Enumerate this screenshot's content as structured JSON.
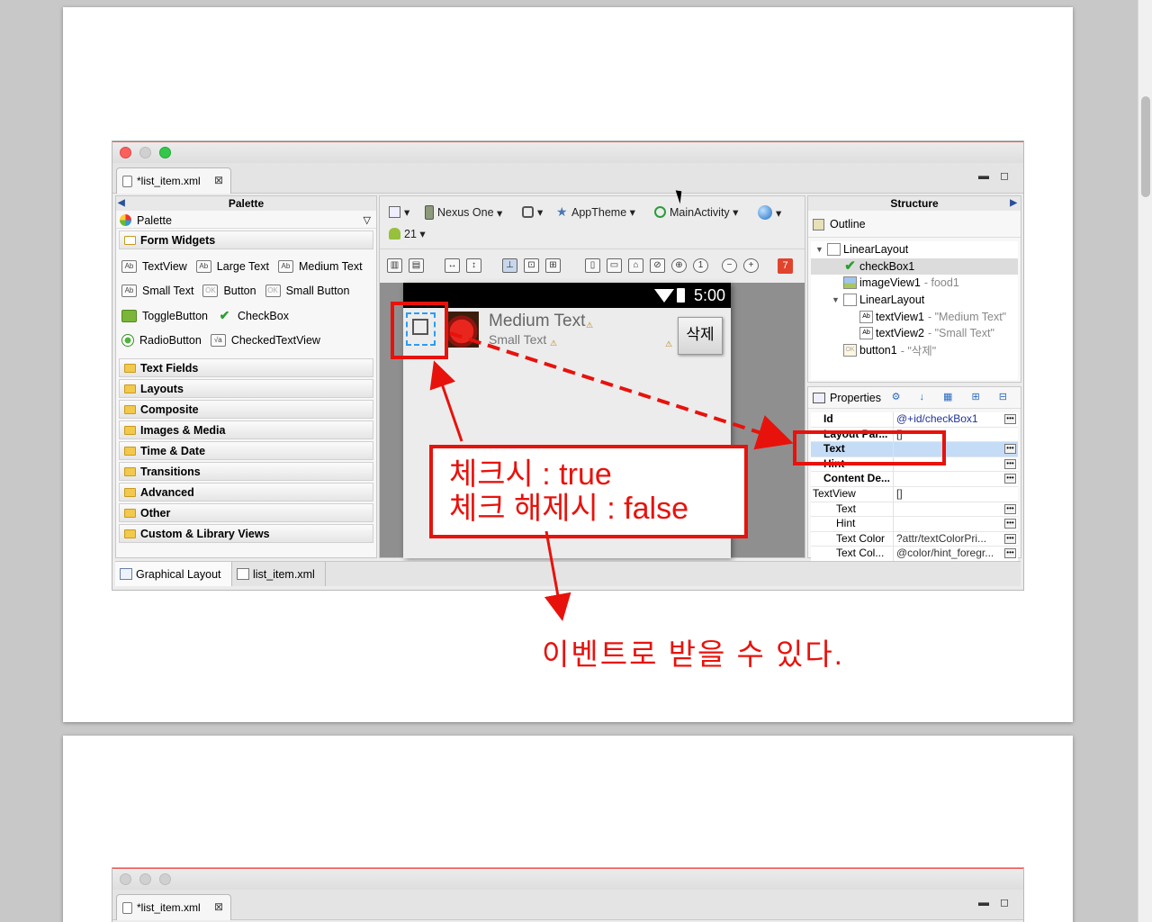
{
  "editor": {
    "file_tab": "*list_item.xml",
    "min_label": "▬",
    "max_label": "◻"
  },
  "palette": {
    "header": "Palette",
    "sub_header": "Palette",
    "form_widgets_label": "Form Widgets",
    "widgets": [
      [
        {
          "icon": "Ab",
          "label": "TextView"
        },
        {
          "icon": "Ab",
          "label": "Large Text"
        },
        {
          "icon": "Ab",
          "label": "Medium Text"
        }
      ],
      [
        {
          "icon": "Ab",
          "label": "Small Text"
        },
        {
          "icon": "OK",
          "label": "Button"
        },
        {
          "icon": "OK",
          "label": "Small Button"
        }
      ],
      [
        {
          "icon": "",
          "label": "ToggleButton"
        },
        {
          "icon": "✔",
          "label": "CheckBox"
        }
      ],
      [
        {
          "icon": "",
          "label": "RadioButton"
        },
        {
          "icon": "√a",
          "label": "CheckedTextView"
        }
      ]
    ],
    "categories": [
      "Text Fields",
      "Layouts",
      "Composite",
      "Images & Media",
      "Time & Date",
      "Transitions",
      "Advanced",
      "Other",
      "Custom & Library Views"
    ]
  },
  "toolbar": {
    "device": "Nexus One",
    "theme": "AppTheme",
    "activity": "MainActivity",
    "api_level": "21",
    "error_count": "7"
  },
  "preview": {
    "time": "5:00",
    "medium_text": "Medium Text",
    "small_text": "Small Text",
    "delete_button": "삭제"
  },
  "structure": {
    "header": "Structure",
    "outline_label": "Outline",
    "tree": [
      {
        "name": "LinearLayout",
        "meta": ""
      },
      {
        "name": "checkBox1",
        "meta": ""
      },
      {
        "name": "imageView1",
        "meta": "- food1"
      },
      {
        "name": "LinearLayout",
        "meta": ""
      },
      {
        "name": "textView1",
        "meta": "- \"Medium Text\""
      },
      {
        "name": "textView2",
        "meta": "- \"Small Text\""
      },
      {
        "name": "button1",
        "meta": "- \"삭제\""
      }
    ]
  },
  "properties": {
    "header": "Properties",
    "rows": [
      {
        "key": "Id",
        "value": "@+id/checkBox1"
      },
      {
        "key": "Layout Par...",
        "value": "[]"
      },
      {
        "key": "Text",
        "value": ""
      },
      {
        "key": "Hint",
        "value": ""
      },
      {
        "key": "Content De...",
        "value": ""
      },
      {
        "key": "TextView",
        "value": "[]"
      },
      {
        "key": "Text",
        "value": ""
      },
      {
        "key": "Hint",
        "value": ""
      },
      {
        "key": "Text Color",
        "value": "?attr/textColorPri..."
      },
      {
        "key": "Text Col...",
        "value": "@color/hint_foregr..."
      }
    ]
  },
  "bottom_tabs": [
    "Graphical Layout",
    "list_item.xml"
  ],
  "annotations": {
    "note_line1": "체크시 : true",
    "note_line2": "체크 해제시 : false",
    "caption": "이벤트로 받을 수 있다."
  },
  "colors": {
    "annotation_red": "#e8120c",
    "selection_blue": "#2a9df4",
    "highlight_row": "#c5dcf7"
  }
}
